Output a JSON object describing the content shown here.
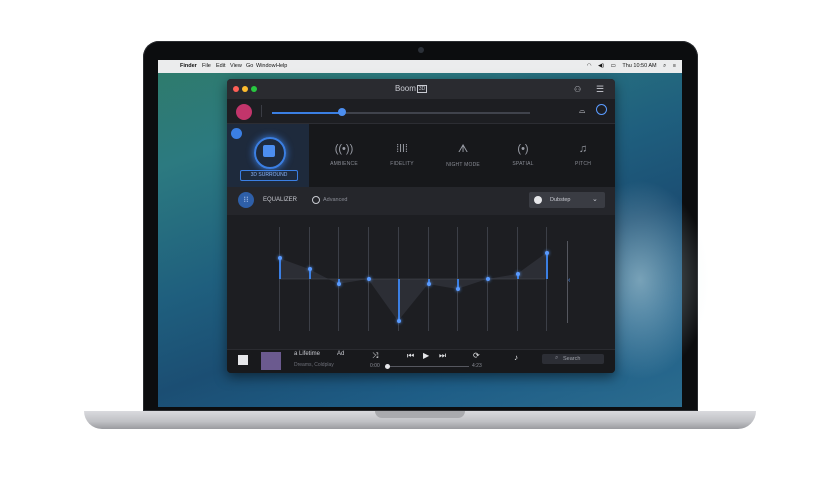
{
  "menubar": {
    "apple": "",
    "items": [
      "Finder",
      "File",
      "Edit",
      "View",
      "Go",
      "Window",
      "Help"
    ],
    "clock": "Thu 10:50 AM"
  },
  "app": {
    "title": "Boom",
    "title_badge": "3D",
    "volume_percent": 27,
    "accent": "#3b7fe3"
  },
  "effects": {
    "surround_label": "3D SURROUND",
    "items": [
      {
        "label": "AMBIENCE",
        "icon": "ambience-icon",
        "glyph": "((•))"
      },
      {
        "label": "FIDELITY",
        "icon": "fidelity-icon",
        "glyph": "⁞ǀǀ⁞"
      },
      {
        "label": "NIGHT MODE",
        "icon": "night-mode-icon",
        "glyph": "ᗑ"
      },
      {
        "label": "SPATIAL",
        "icon": "spatial-icon",
        "glyph": "(•)"
      },
      {
        "label": "PITCH",
        "icon": "pitch-icon",
        "glyph": "♫"
      }
    ]
  },
  "equalizer": {
    "label": "EQUALIZER",
    "advanced_label": "Advanced",
    "preset": "Dubstep",
    "band_levels": [
      0.7,
      0.6,
      0.45,
      0.5,
      0.1,
      0.45,
      0.4,
      0.5,
      0.55,
      0.75
    ]
  },
  "player": {
    "track_title": "a Lifetime",
    "track_artist": "Dreams, Coldplay",
    "badge": "Ad",
    "time_elapsed": "0:00",
    "time_total": "4:23",
    "progress_fraction": 0.0,
    "search_label": "Search"
  }
}
